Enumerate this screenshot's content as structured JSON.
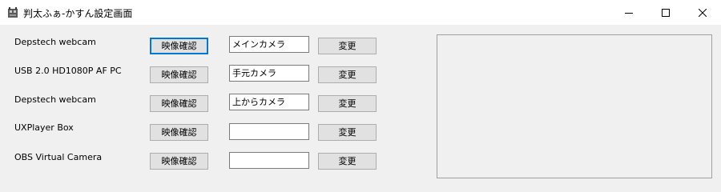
{
  "window": {
    "title": "判太ふぁ-かすん設定画面",
    "controls": {
      "minimize": "minimize-icon",
      "maximize": "maximize-icon",
      "close": "close-icon"
    }
  },
  "cameras": [
    {
      "device": "Depstech webcam",
      "preview_button": "映像確認",
      "name_value": "メインカメラ",
      "change_button": "変更"
    },
    {
      "device": "USB 2.0 HD1080P AF PC",
      "preview_button": "映像確認",
      "name_value": "手元カメラ",
      "change_button": "変更"
    },
    {
      "device": "Depstech webcam",
      "preview_button": "映像確認",
      "name_value": "上からカメラ",
      "change_button": "変更"
    },
    {
      "device": "UXPlayer Box",
      "preview_button": "映像確認",
      "name_value": "",
      "change_button": "変更"
    },
    {
      "device": "OBS Virtual Camera",
      "preview_button": "映像確認",
      "name_value": "",
      "change_button": "変更"
    }
  ],
  "colors": {
    "accent": "#0078d7",
    "window_bg": "#f0f0f0",
    "button_bg": "#e1e1e1"
  }
}
